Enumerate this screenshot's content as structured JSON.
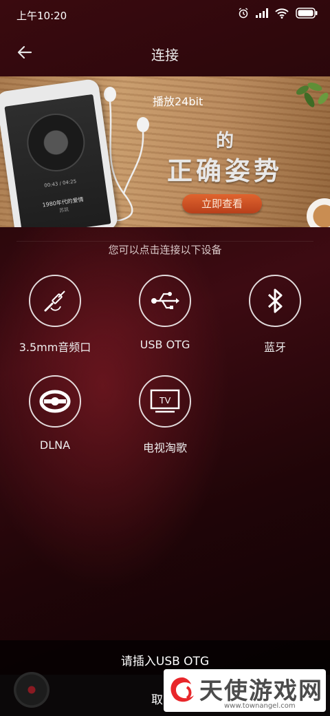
{
  "status_bar": {
    "time": "上午10:20"
  },
  "header": {
    "title": "连接"
  },
  "banner": {
    "headline_1": "播放24bit",
    "headline_2": "的",
    "headline_3": "正确姿势",
    "cta": "立即查看",
    "phone_time": "00:43 / 04:25",
    "phone_song": "1980年代的爱情",
    "phone_artist": "苏凯"
  },
  "subtitle": "您可以点击连接以下设备",
  "devices": [
    {
      "label": "3.5mm音频口",
      "icon": "headphone-jack-icon"
    },
    {
      "label": "USB OTG",
      "icon": "usb-icon"
    },
    {
      "label": "蓝牙",
      "icon": "bluetooth-icon"
    },
    {
      "label": "DLNA",
      "icon": "dlna-icon"
    },
    {
      "label": "电视淘歌",
      "icon": "tv-icon",
      "icon_text": "TV"
    }
  ],
  "notice": "请插入USB OTG",
  "player": {
    "fragment": "取"
  },
  "watermark": {
    "brand": "天使游戏网",
    "url": "www.townangel.com"
  }
}
